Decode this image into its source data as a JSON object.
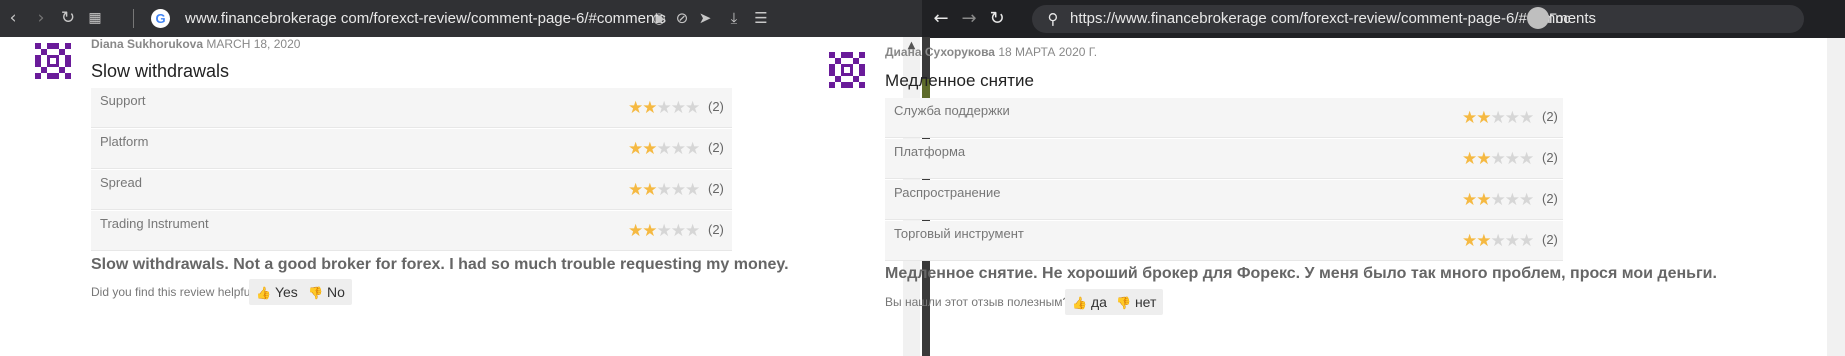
{
  "left": {
    "url": "www.financebrokerage com/forexct-review/comment-page-6/#comments",
    "review": {
      "author": "Diana Sukhorukova",
      "date": "MARCH 18, 2020",
      "title": "Slow withdrawals",
      "ratings": [
        {
          "label": "Support",
          "stars": 2,
          "count": "(2)"
        },
        {
          "label": "Platform",
          "stars": 2,
          "count": "(2)"
        },
        {
          "label": "Spread",
          "stars": 2,
          "count": "(2)"
        },
        {
          "label": "Trading Instrument",
          "stars": 2,
          "count": "(2)"
        }
      ],
      "body": "Slow withdrawals. Not a good broker for forex. I had so much trouble requesting my money.",
      "helpful_q": "Did you find this review helpful?",
      "yes": "Yes",
      "no": "No"
    }
  },
  "right": {
    "url": "https://www.financebrokerage com/forexct-review/comment-page-6/#comments",
    "profile_label": "Гос",
    "review": {
      "author": "Диана Сухорукова",
      "date": "18 МАРТА 2020 Г.",
      "title": "Медленное снятие",
      "ratings": [
        {
          "label": "Служба поддержки",
          "stars": 2,
          "count": "(2)"
        },
        {
          "label": "Платформа",
          "stars": 2,
          "count": "(2)"
        },
        {
          "label": "Распространение",
          "stars": 2,
          "count": "(2)"
        },
        {
          "label": "Торговый инструмент",
          "stars": 2,
          "count": "(2)"
        }
      ],
      "body": "Медленное снятие. Не хороший брокер для Форекс. У меня было так много проблем, прося мои деньги.",
      "helpful_q": "Вы нашли этот отзыв полезным?",
      "yes": "да",
      "no": "нет"
    }
  },
  "icons": {
    "back": "back-arrow-icon",
    "forward": "forward-arrow-icon",
    "reload": "reload-icon",
    "grid": "grid-icon",
    "camera": "camera-icon",
    "block": "block-icon",
    "send": "send-icon",
    "download": "download-icon",
    "menu": "menu-icon",
    "thumbs_up": "thumbs-up-icon",
    "thumbs_down": "thumbs-down-icon",
    "star": "star-icon"
  },
  "colors": {
    "star_on": "#f5b942",
    "star_off": "#d6d6d6",
    "avatar": "#6a1b9a"
  }
}
